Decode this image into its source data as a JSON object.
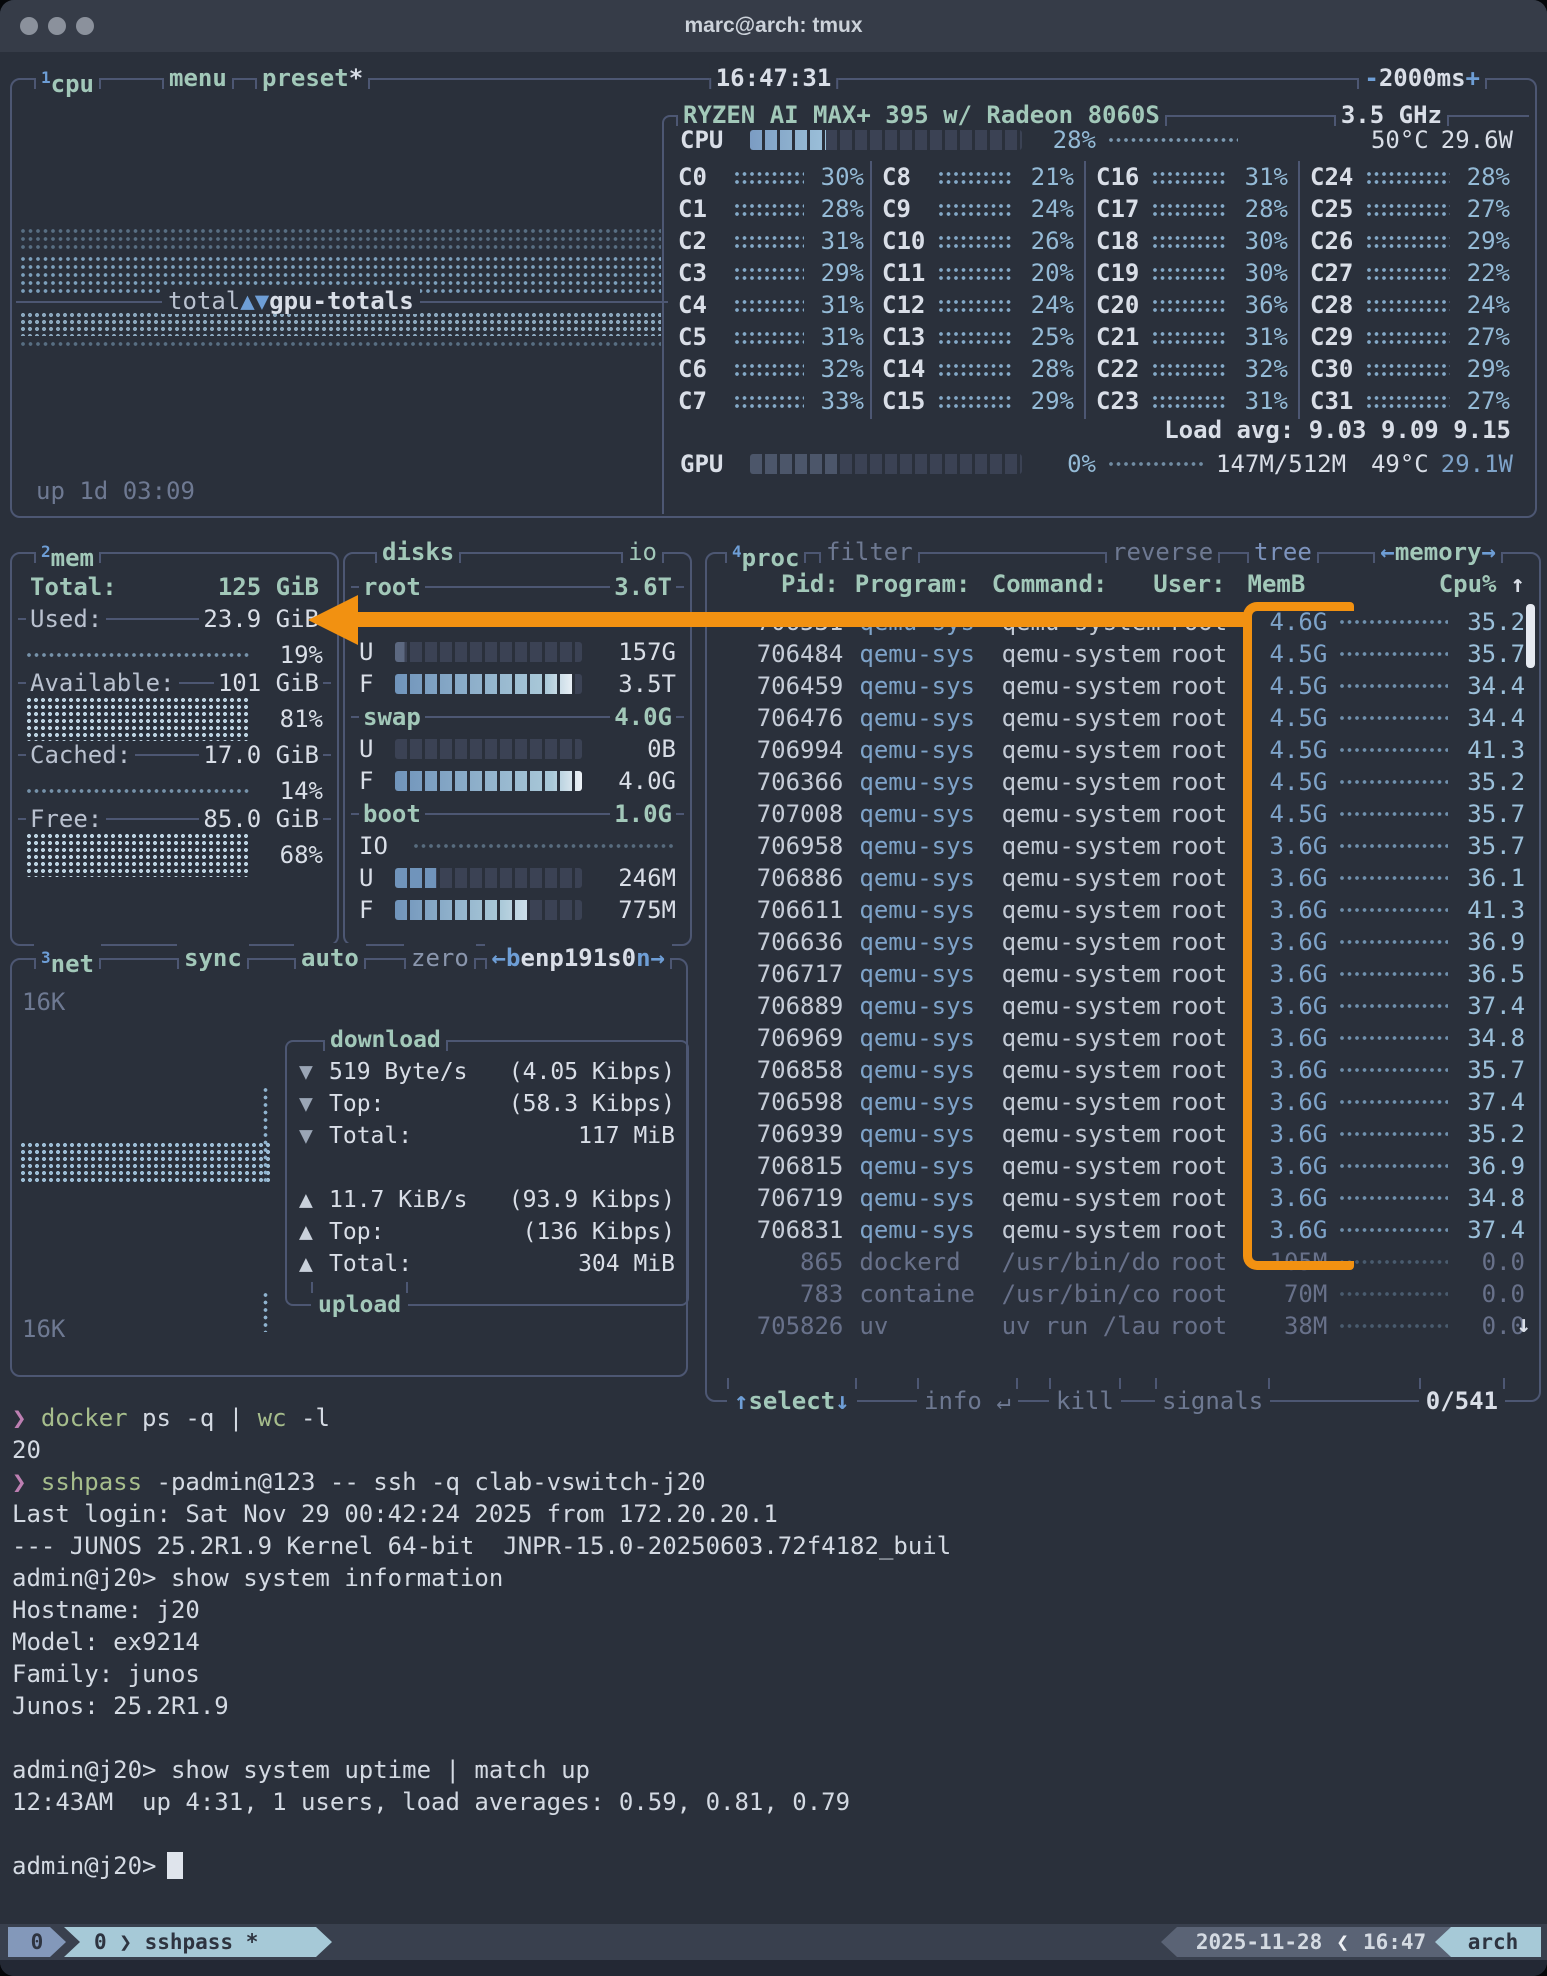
{
  "window": {
    "title": "marc@arch: tmux"
  },
  "cpu": {
    "box_num": "1",
    "box_label": "cpu",
    "menu": "menu",
    "preset": "preset",
    "preset_star": "*",
    "clock": "16:47:31",
    "rate_minus": "-",
    "rate": "2000ms",
    "rate_plus": "+",
    "model": "RYZEN AI MAX+ 395 w/ Radeon 8060S",
    "freq": "3.5 GHz",
    "total_label": "CPU",
    "total_pct": "28%",
    "total_temp": "50°C",
    "total_watts": "29.6W",
    "bar_fill": "28%",
    "gpu_bar_fill": "33%",
    "divider_left": "total",
    "divider_arrows": "▲▼",
    "divider_right": "gpu-totals",
    "load_avg": "Load avg: 9.03 9.09 9.15",
    "gpu_label": "GPU",
    "gpu_pct": "0%",
    "gpu_vram": "147M/512M",
    "gpu_temp": "49°C",
    "gpu_watts": "29.1W",
    "uptime": "up 1d 03:09",
    "core_cols": [
      [
        {
          "l": "C0",
          "p": "30%"
        },
        {
          "l": "C1",
          "p": "28%"
        },
        {
          "l": "C2",
          "p": "31%"
        },
        {
          "l": "C3",
          "p": "29%"
        },
        {
          "l": "C4",
          "p": "31%"
        },
        {
          "l": "C5",
          "p": "31%"
        },
        {
          "l": "C6",
          "p": "32%"
        },
        {
          "l": "C7",
          "p": "33%"
        }
      ],
      [
        {
          "l": "C8",
          "p": "21%"
        },
        {
          "l": "C9",
          "p": "24%"
        },
        {
          "l": "C10",
          "p": "26%"
        },
        {
          "l": "C11",
          "p": "20%"
        },
        {
          "l": "C12",
          "p": "24%"
        },
        {
          "l": "C13",
          "p": "25%"
        },
        {
          "l": "C14",
          "p": "28%"
        },
        {
          "l": "C15",
          "p": "29%"
        }
      ],
      [
        {
          "l": "C16",
          "p": "31%"
        },
        {
          "l": "C17",
          "p": "28%"
        },
        {
          "l": "C18",
          "p": "30%"
        },
        {
          "l": "C19",
          "p": "30%"
        },
        {
          "l": "C20",
          "p": "36%"
        },
        {
          "l": "C21",
          "p": "31%"
        },
        {
          "l": "C22",
          "p": "32%"
        },
        {
          "l": "C23",
          "p": "31%"
        }
      ],
      [
        {
          "l": "C24",
          "p": "28%"
        },
        {
          "l": "C25",
          "p": "27%"
        },
        {
          "l": "C26",
          "p": "29%"
        },
        {
          "l": "C27",
          "p": "22%"
        },
        {
          "l": "C28",
          "p": "24%"
        },
        {
          "l": "C29",
          "p": "27%"
        },
        {
          "l": "C30",
          "p": "29%"
        },
        {
          "l": "C31",
          "p": "27%"
        }
      ]
    ]
  },
  "mem": {
    "box_num": "2",
    "box_label": "mem",
    "total_label": "Total:",
    "total_value": "125 GiB",
    "used_label": "Used:",
    "used_value": "23.9 GiB",
    "used_pct": "19%",
    "avail_label": "Available:",
    "avail_value": "101 GiB",
    "avail_pct": "81%",
    "cached_label": "Cached:",
    "cached_value": "17.0 GiB",
    "cached_pct": "14%",
    "free_label": "Free:",
    "free_value": "85.0 GiB",
    "free_pct": "68%"
  },
  "disks": {
    "box_label": "disks",
    "io_label": "io",
    "u_label": "U",
    "f_label": "F",
    "root": {
      "name": "root",
      "size": "3.6T",
      "used": "157G",
      "free": "3.5T",
      "u_fill": "5%",
      "f_fill": "96%"
    },
    "swap": {
      "name": "swap",
      "size": "4.0G",
      "used": "0B",
      "free": "4.0G",
      "u_fill": "0%",
      "f_fill": "100%"
    },
    "boot": {
      "name": "boot",
      "size": "1.0G",
      "io_row_label": "IO",
      "used": "246M",
      "free": "775M",
      "u_fill": "22%",
      "f_fill": "72%"
    }
  },
  "net": {
    "box_num": "3",
    "box_label": "net",
    "sync": "sync",
    "auto": "auto",
    "zero": "zero",
    "iface_prev": "←b",
    "iface": "enp191s0",
    "iface_next": "n→",
    "scale_top": "16K",
    "scale_bottom": "16K",
    "download": {
      "title": "download",
      "arrow": "▼",
      "rate": "519 Byte/s",
      "rate_bits": "(4.05 Kibps)",
      "top_label": "Top:",
      "top": "(58.3 Kibps)",
      "total_label": "Total:",
      "total": "117 MiB"
    },
    "upload": {
      "title": "upload",
      "arrow": "▲",
      "rate": "11.7 KiB/s",
      "rate_bits": "(93.9 Kibps)",
      "top_label": "Top:",
      "top": "(136 Kibps)",
      "total_label": "Total:",
      "total": "304 MiB"
    }
  },
  "proc": {
    "box_num": "4",
    "box_label": "proc",
    "filter": "filter",
    "reverse": "reverse",
    "tree": "tree",
    "sort_prev": "←",
    "sort": "memory",
    "sort_next": "→",
    "headers": {
      "pid": "Pid:",
      "program": "Program:",
      "command": "Command:",
      "user": "User:",
      "mem": "MemB",
      "cpu": "Cpu%",
      "sort_arrow": "↑"
    },
    "rows": [
      {
        "pid": "706531",
        "prog": "qemu-sys",
        "cmd": "qemu-system",
        "user": "root",
        "mem": "4.6G",
        "cpu": "35.2"
      },
      {
        "pid": "706484",
        "prog": "qemu-sys",
        "cmd": "qemu-system",
        "user": "root",
        "mem": "4.5G",
        "cpu": "35.7"
      },
      {
        "pid": "706459",
        "prog": "qemu-sys",
        "cmd": "qemu-system",
        "user": "root",
        "mem": "4.5G",
        "cpu": "34.4"
      },
      {
        "pid": "706476",
        "prog": "qemu-sys",
        "cmd": "qemu-system",
        "user": "root",
        "mem": "4.5G",
        "cpu": "34.4"
      },
      {
        "pid": "706994",
        "prog": "qemu-sys",
        "cmd": "qemu-system",
        "user": "root",
        "mem": "4.5G",
        "cpu": "41.3"
      },
      {
        "pid": "706366",
        "prog": "qemu-sys",
        "cmd": "qemu-system",
        "user": "root",
        "mem": "4.5G",
        "cpu": "35.2"
      },
      {
        "pid": "707008",
        "prog": "qemu-sys",
        "cmd": "qemu-system",
        "user": "root",
        "mem": "4.5G",
        "cpu": "35.7"
      },
      {
        "pid": "706958",
        "prog": "qemu-sys",
        "cmd": "qemu-system",
        "user": "root",
        "mem": "3.6G",
        "cpu": "35.7"
      },
      {
        "pid": "706886",
        "prog": "qemu-sys",
        "cmd": "qemu-system",
        "user": "root",
        "mem": "3.6G",
        "cpu": "36.1"
      },
      {
        "pid": "706611",
        "prog": "qemu-sys",
        "cmd": "qemu-system",
        "user": "root",
        "mem": "3.6G",
        "cpu": "41.3"
      },
      {
        "pid": "706636",
        "prog": "qemu-sys",
        "cmd": "qemu-system",
        "user": "root",
        "mem": "3.6G",
        "cpu": "36.9"
      },
      {
        "pid": "706717",
        "prog": "qemu-sys",
        "cmd": "qemu-system",
        "user": "root",
        "mem": "3.6G",
        "cpu": "36.5"
      },
      {
        "pid": "706889",
        "prog": "qemu-sys",
        "cmd": "qemu-system",
        "user": "root",
        "mem": "3.6G",
        "cpu": "37.4"
      },
      {
        "pid": "706969",
        "prog": "qemu-sys",
        "cmd": "qemu-system",
        "user": "root",
        "mem": "3.6G",
        "cpu": "34.8"
      },
      {
        "pid": "706858",
        "prog": "qemu-sys",
        "cmd": "qemu-system",
        "user": "root",
        "mem": "3.6G",
        "cpu": "35.7"
      },
      {
        "pid": "706598",
        "prog": "qemu-sys",
        "cmd": "qemu-system",
        "user": "root",
        "mem": "3.6G",
        "cpu": "37.4"
      },
      {
        "pid": "706939",
        "prog": "qemu-sys",
        "cmd": "qemu-system",
        "user": "root",
        "mem": "3.6G",
        "cpu": "35.2"
      },
      {
        "pid": "706815",
        "prog": "qemu-sys",
        "cmd": "qemu-system",
        "user": "root",
        "mem": "3.6G",
        "cpu": "36.9"
      },
      {
        "pid": "706719",
        "prog": "qemu-sys",
        "cmd": "qemu-system",
        "user": "root",
        "mem": "3.6G",
        "cpu": "34.8"
      },
      {
        "pid": "706831",
        "prog": "qemu-sys",
        "cmd": "qemu-system",
        "user": "root",
        "mem": "3.6G",
        "cpu": "37.4"
      }
    ],
    "dim_rows": [
      {
        "pid": "865",
        "prog": "dockerd",
        "cmd": "/usr/bin/do",
        "user": "root",
        "mem": "105M",
        "cpu": "0.0"
      },
      {
        "pid": "783",
        "prog": "containe",
        "cmd": "/usr/bin/co",
        "user": "root",
        "mem": "70M",
        "cpu": "0.0"
      },
      {
        "pid": "705826",
        "prog": "uv",
        "cmd": "uv run /lau",
        "user": "root",
        "mem": "38M",
        "cpu": "0.0"
      }
    ],
    "more_arrow": "↓",
    "footer": {
      "sel_up": "↑",
      "select": "select",
      "sel_down": "↓",
      "info": "info ↵",
      "kill": "kill",
      "signals": "signals",
      "count": "0/541"
    }
  },
  "shell": {
    "prompt": "❯ ",
    "l1": {
      "c1": "docker",
      "a1": " ps -q | ",
      "c2": "wc",
      "a2": " -l"
    },
    "l2": "20",
    "l3": {
      "c1": "sshpass",
      "a1": " -padmin@123 -- ssh -q clab-vswitch-j20"
    },
    "l4": "Last login: Sat Nov 29 00:42:24 2025 from 172.20.20.1",
    "l5": "--- JUNOS 25.2R1.9 Kernel 64-bit  JNPR-15.0-20250603.72f4182_buil",
    "l6": "admin@j20> show system information",
    "l7": "Hostname: j20",
    "l8": "Model: ex9214",
    "l9": "Family: junos",
    "l10": "Junos: 25.2R1.9",
    "l11": "admin@j20> show system uptime | match up",
    "l12": "12:43AM  up 4:31, 1 users, load averages: 0.59, 0.81, 0.79",
    "l13": "admin@j20>"
  },
  "statusbar": {
    "session": "0",
    "window": "0 ❯ sshpass *",
    "date": "2025-11-28",
    "sep": "❮",
    "time": "16:47",
    "host": "arch"
  },
  "colors": {
    "accent_teal": "#a2c8b9",
    "accent_blue": "#6e9ed6",
    "annotation_orange": "#f29111",
    "bg": "#2a303b"
  }
}
